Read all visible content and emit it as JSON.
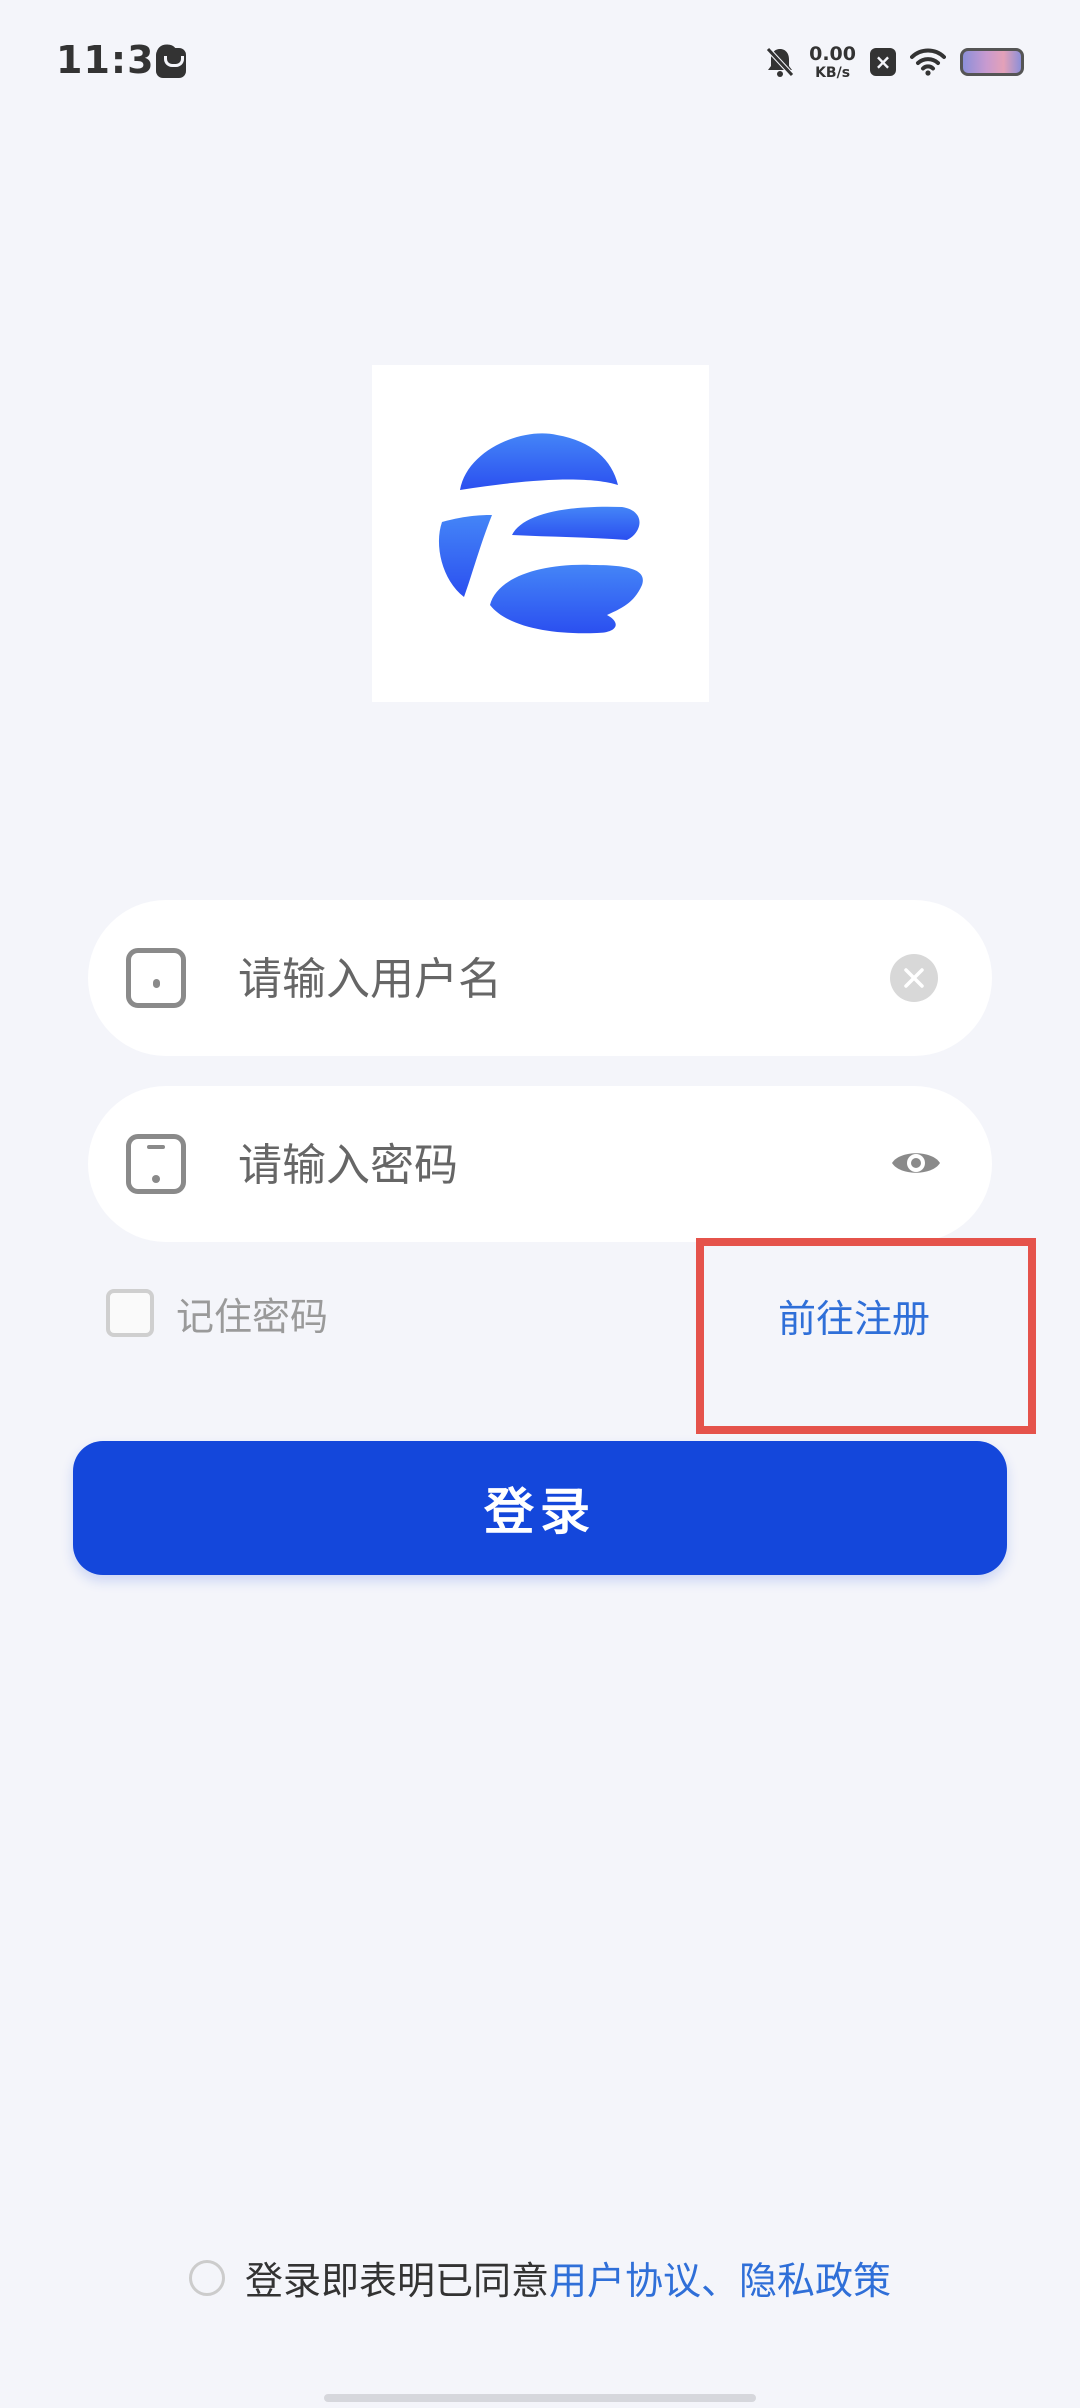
{
  "status_bar": {
    "time": "11:39",
    "net_speed_value": "0.00",
    "net_speed_unit": "KB/s",
    "icons": [
      "shopping-bag-icon",
      "mute-bell-icon",
      "sim-no-signal-icon",
      "wifi-icon",
      "battery-icon"
    ]
  },
  "logo": {
    "icon": "app-logo-icon",
    "colors": [
      "#3f7cf5",
      "#2f55f0"
    ]
  },
  "form": {
    "username_placeholder": "请输入用户名",
    "username_value": "",
    "password_placeholder": "请输入密码",
    "password_value": "",
    "remember_label": "记住密码",
    "remember_checked": false,
    "register_link": "前往注册",
    "login_button": "登录"
  },
  "agreement": {
    "prefix": "登录即表明已同意",
    "user_agreement": "用户协议",
    "separator": "、",
    "privacy_policy": "隐私政策",
    "checked": false
  },
  "colors": {
    "background": "#f4f5fa",
    "primary": "#1447db",
    "link": "#2f6fd8",
    "highlight": "#e5534b"
  }
}
